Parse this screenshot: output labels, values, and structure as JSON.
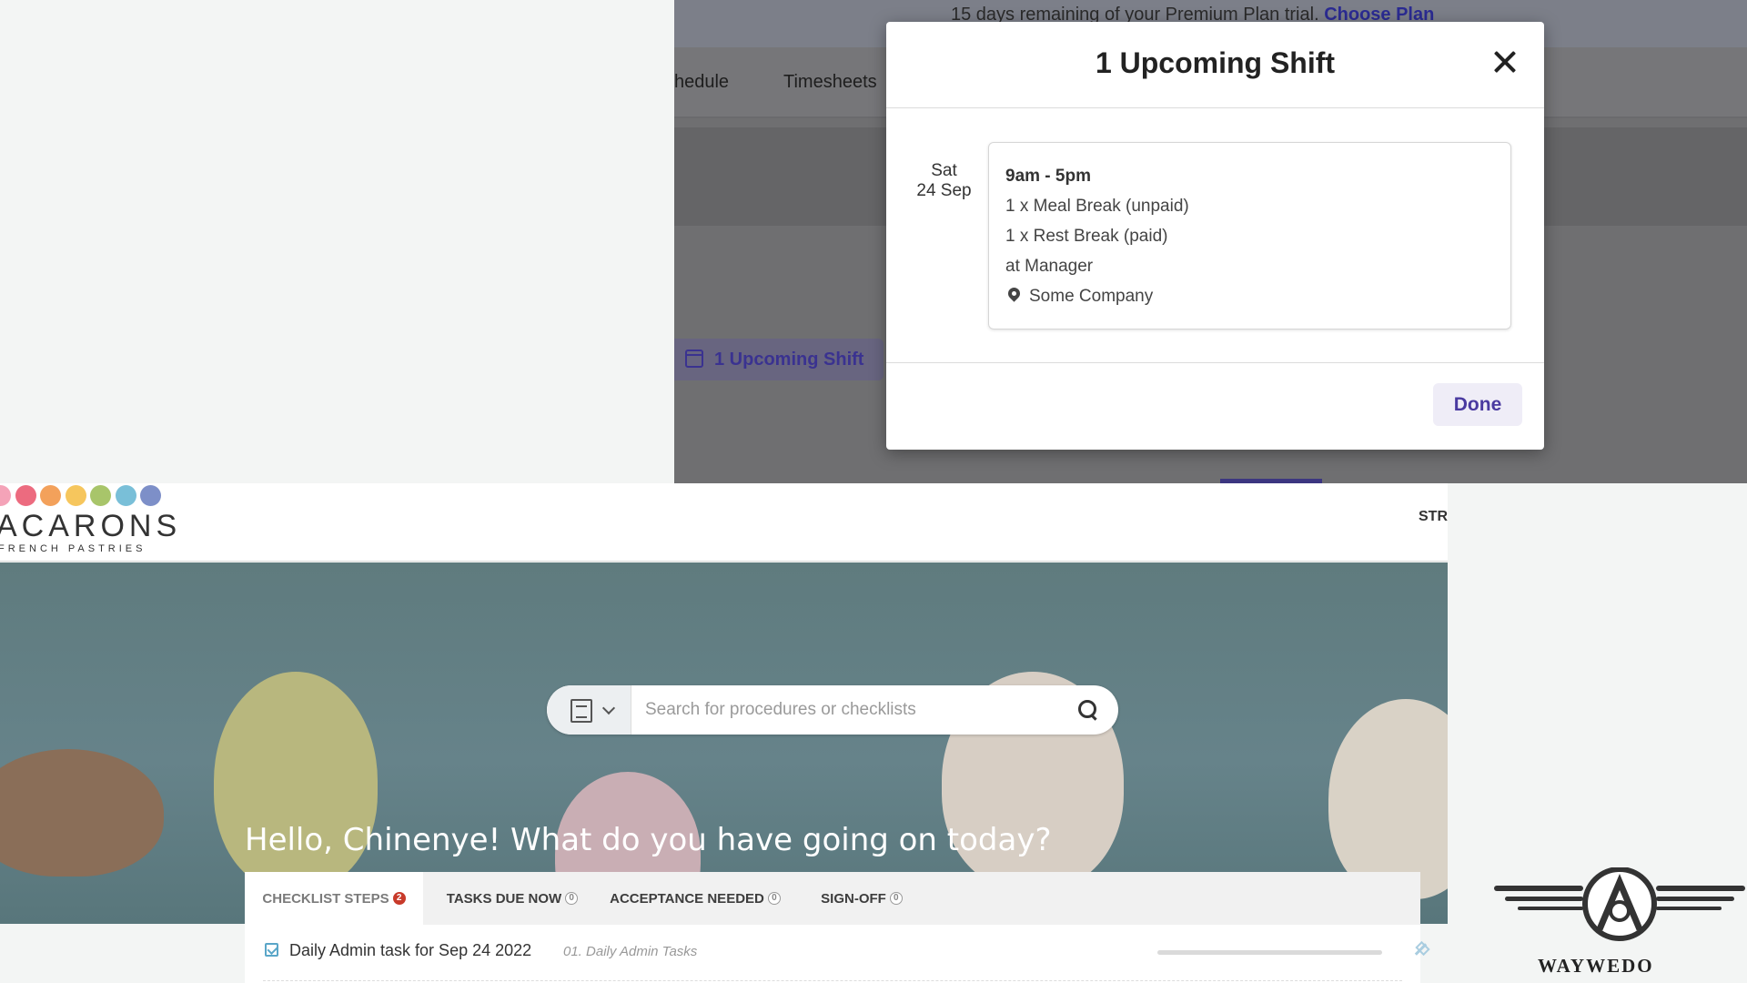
{
  "background_app": {
    "trial_banner": {
      "text": "15 days remaining of your Premium Plan trial.",
      "link_text": "Choose Plan"
    },
    "nav": [
      {
        "label": "hedule"
      },
      {
        "label": "Timesheets"
      }
    ],
    "upcoming_chip": {
      "label": "1 Upcoming Shift",
      "icon": "calendar-icon"
    }
  },
  "modal": {
    "title": "1 Upcoming Shift",
    "close_icon": "close-icon",
    "shift": {
      "day": "Sat",
      "date": "24 Sep",
      "time": "9am - 5pm",
      "meal_break": "1 x Meal Break (unpaid)",
      "rest_break": "1 x Rest Break (paid)",
      "role": "at Manager",
      "location": "Some Company",
      "location_icon": "map-pin-icon"
    },
    "done_label": "Done"
  },
  "app": {
    "logo": {
      "text": "ACARONS",
      "subtext": "FRENCH PASTRIES",
      "dot_colors": [
        "#f4a3b8",
        "#ec6b7f",
        "#f3a15b",
        "#f6c65d",
        "#a8c56a",
        "#79bfd8",
        "#7d8fc8"
      ]
    },
    "header_right": "STR",
    "search": {
      "placeholder": "Search for procedures or checklists",
      "type_icon": "document-icon",
      "dropdown_icon": "chevron-down-icon",
      "search_icon": "search-icon"
    },
    "greeting": "Hello, Chinenye! What do you have going on today?",
    "tabs": [
      {
        "label": "CHECKLIST STEPS",
        "badge": "2",
        "active": true
      },
      {
        "label": "TASKS DUE NOW",
        "badge": "0",
        "active": false
      },
      {
        "label": "ACCEPTANCE NEEDED",
        "badge": "0",
        "active": false
      },
      {
        "label": "SIGN-OFF",
        "badge": "0",
        "active": false
      }
    ],
    "task": {
      "title": "Daily Admin task for Sep 24 2022",
      "category": "01. Daily Admin Tasks",
      "progress": 0
    }
  },
  "brand_logo": {
    "text": "WAYWEDO"
  },
  "colors": {
    "accent_purple": "#4a3aa0",
    "badge_red": "#c83a2a",
    "check_blue": "#5aa6c8"
  }
}
